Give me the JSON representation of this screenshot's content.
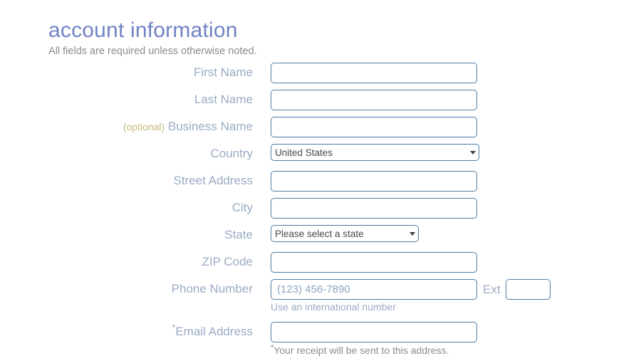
{
  "header": {
    "title": "account information",
    "subtitle": "All fields are required unless otherwise noted."
  },
  "form": {
    "fields": {
      "first_name": {
        "label": "First Name",
        "value": "",
        "placeholder": ""
      },
      "last_name": {
        "label": "Last Name",
        "value": "",
        "placeholder": ""
      },
      "business_name": {
        "optional_tag": "(optional)",
        "label": "Business Name",
        "value": "",
        "placeholder": ""
      },
      "country": {
        "label": "Country",
        "selected": "United States",
        "dropdown_icon": "chevron-down-icon"
      },
      "street_address": {
        "label": "Street Address",
        "value": "",
        "placeholder": ""
      },
      "city": {
        "label": "City",
        "value": "",
        "placeholder": ""
      },
      "state": {
        "label": "State",
        "selected": "Please select a state",
        "dropdown_icon": "chevron-down-icon"
      },
      "zip_code": {
        "label": "ZIP Code",
        "value": "",
        "placeholder": ""
      },
      "phone_number": {
        "label": "Phone Number",
        "value": "",
        "placeholder": "(123) 456-7890",
        "ext_label": "Ext",
        "ext_value": "",
        "ext_placeholder": "",
        "helper_text": "Use an international number"
      },
      "email_address": {
        "asterisk": "*",
        "label": "Email Address",
        "value": "",
        "placeholder": "",
        "helper_asterisk": "*",
        "helper_text": "Your receipt will be sent to this address."
      }
    }
  },
  "colors": {
    "title": "#7182c4",
    "label": "#9aabc4",
    "optional": "#c3bb7c",
    "input_border": "#4a7ba6",
    "gray_text": "#8c8c8c",
    "background": "#ffffff"
  }
}
